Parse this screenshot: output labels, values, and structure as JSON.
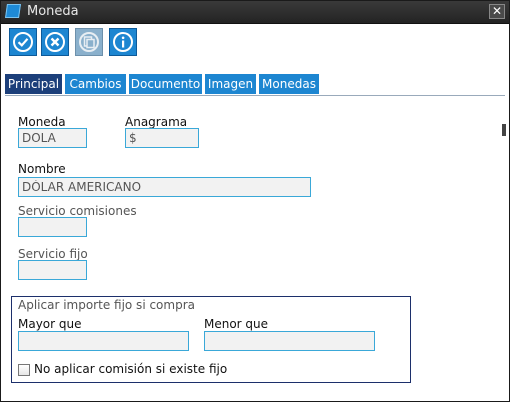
{
  "window": {
    "title": "Moneda",
    "close_glyph": "✕"
  },
  "toolbar": {
    "buttons": [
      {
        "icon": "check-icon",
        "label": "Aceptar"
      },
      {
        "icon": "cancel-icon",
        "label": "Cancelar"
      },
      {
        "icon": "copy-icon",
        "label": "Copiar",
        "disabled": true
      },
      {
        "icon": "info-icon",
        "label": "Información"
      }
    ]
  },
  "tabs": [
    {
      "label": "Principal",
      "active": true
    },
    {
      "label": "Cambios"
    },
    {
      "label": "Documento"
    },
    {
      "label": "Imagen"
    },
    {
      "label": "Monedas"
    }
  ],
  "form": {
    "moneda": {
      "label": "Moneda",
      "value": "DOLA"
    },
    "anagrama": {
      "label": "Anagrama",
      "value": "$"
    },
    "nombre": {
      "label": "Nombre",
      "value": "DÓLAR AMERICANO"
    },
    "servicio_comisiones": {
      "label": "Servicio comisiones",
      "value": ""
    },
    "servicio_fijo": {
      "label": "Servicio fijo",
      "value": ""
    }
  },
  "group": {
    "title": "Aplicar importe fijo si compra",
    "mayor_que": {
      "label": "Mayor que",
      "value": ""
    },
    "menor_que": {
      "label": "Menor que",
      "value": ""
    },
    "checkbox_label": "No aplicar comisión si existe fijo",
    "checked": false
  },
  "colors": {
    "accent": "#1d86d1",
    "active_tab": "#1c3f7a",
    "field_border": "#3aa8d8",
    "group_border": "#1c2f6b"
  }
}
